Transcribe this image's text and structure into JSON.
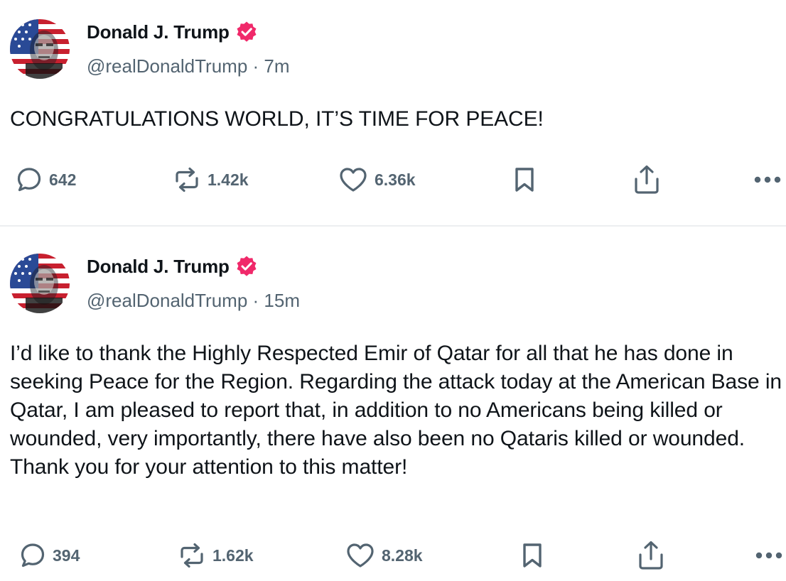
{
  "colors": {
    "verified_badge": "#f0296a",
    "text_primary": "#0f1419",
    "text_secondary": "#536471",
    "icon_gray": "#536471"
  },
  "icons": {
    "reply": "speech-bubble-icon",
    "repost": "repost-arrows-icon",
    "like": "heart-icon",
    "bookmark": "bookmark-icon",
    "share": "share-upload-icon",
    "more": "ellipsis-icon",
    "verified": "verified-badge-icon",
    "avatar": "flag-portrait-avatar"
  },
  "posts": [
    {
      "author": {
        "display_name": "Donald J. Trump",
        "handle_time": "@realDonaldTrump · 7m"
      },
      "text": "CONGRATULATIONS WORLD, IT’S TIME FOR PEACE!",
      "stats": {
        "replies": "642",
        "reposts": "1.42k",
        "likes": "6.36k"
      }
    },
    {
      "author": {
        "display_name": "Donald J. Trump",
        "handle_time": "@realDonaldTrump · 15m"
      },
      "text": "I’d like to thank the Highly Respected Emir of Qatar for all that he has done in seeking Peace for the Region. Regarding the attack today at the American Base in Qatar, I am pleased to report that, in addition to no Americans being killed or wounded, very importantly, there have also been no Qataris killed or wounded. Thank you for your attention to this matter!",
      "stats": {
        "replies": "394",
        "reposts": "1.62k",
        "likes": "8.28k"
      }
    }
  ]
}
